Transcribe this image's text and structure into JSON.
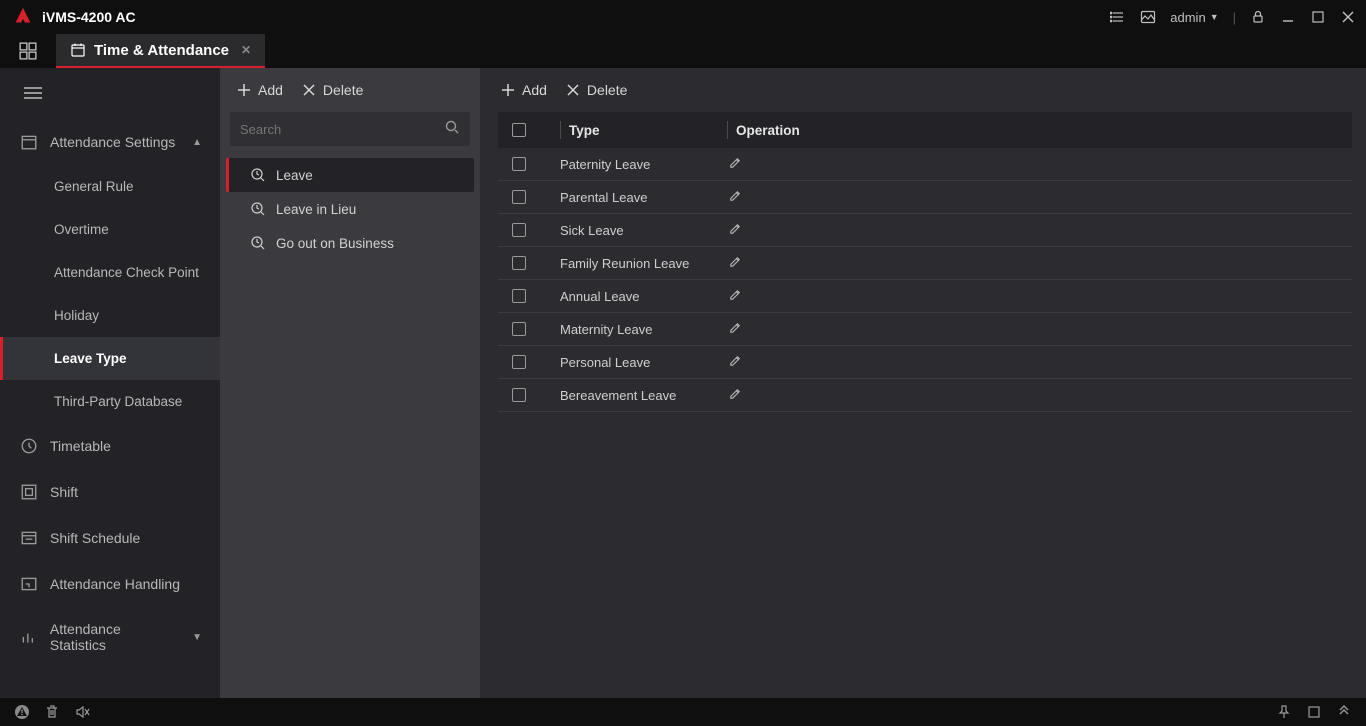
{
  "app": {
    "title": "iVMS-4200 AC",
    "user": "admin"
  },
  "tab": {
    "label": "Time & Attendance"
  },
  "sidebar": {
    "group": "Attendance Settings",
    "items": [
      "General Rule",
      "Overtime",
      "Attendance Check Point",
      "Holiday",
      "Leave Type",
      "Third-Party Database"
    ],
    "bottom": [
      "Timetable",
      "Shift",
      "Shift Schedule",
      "Attendance Handling",
      "Attendance Statistics"
    ]
  },
  "midpanel": {
    "add": "Add",
    "delete": "Delete",
    "search_placeholder": "Search",
    "categories": [
      "Leave",
      "Leave in Lieu",
      "Go out on Business"
    ]
  },
  "content": {
    "add": "Add",
    "delete": "Delete",
    "headers": {
      "type": "Type",
      "operation": "Operation"
    },
    "rows": [
      "Paternity Leave",
      "Parental Leave",
      "Sick Leave",
      "Family Reunion Leave",
      "Annual Leave",
      "Maternity Leave",
      "Personal Leave",
      "Bereavement Leave"
    ]
  }
}
